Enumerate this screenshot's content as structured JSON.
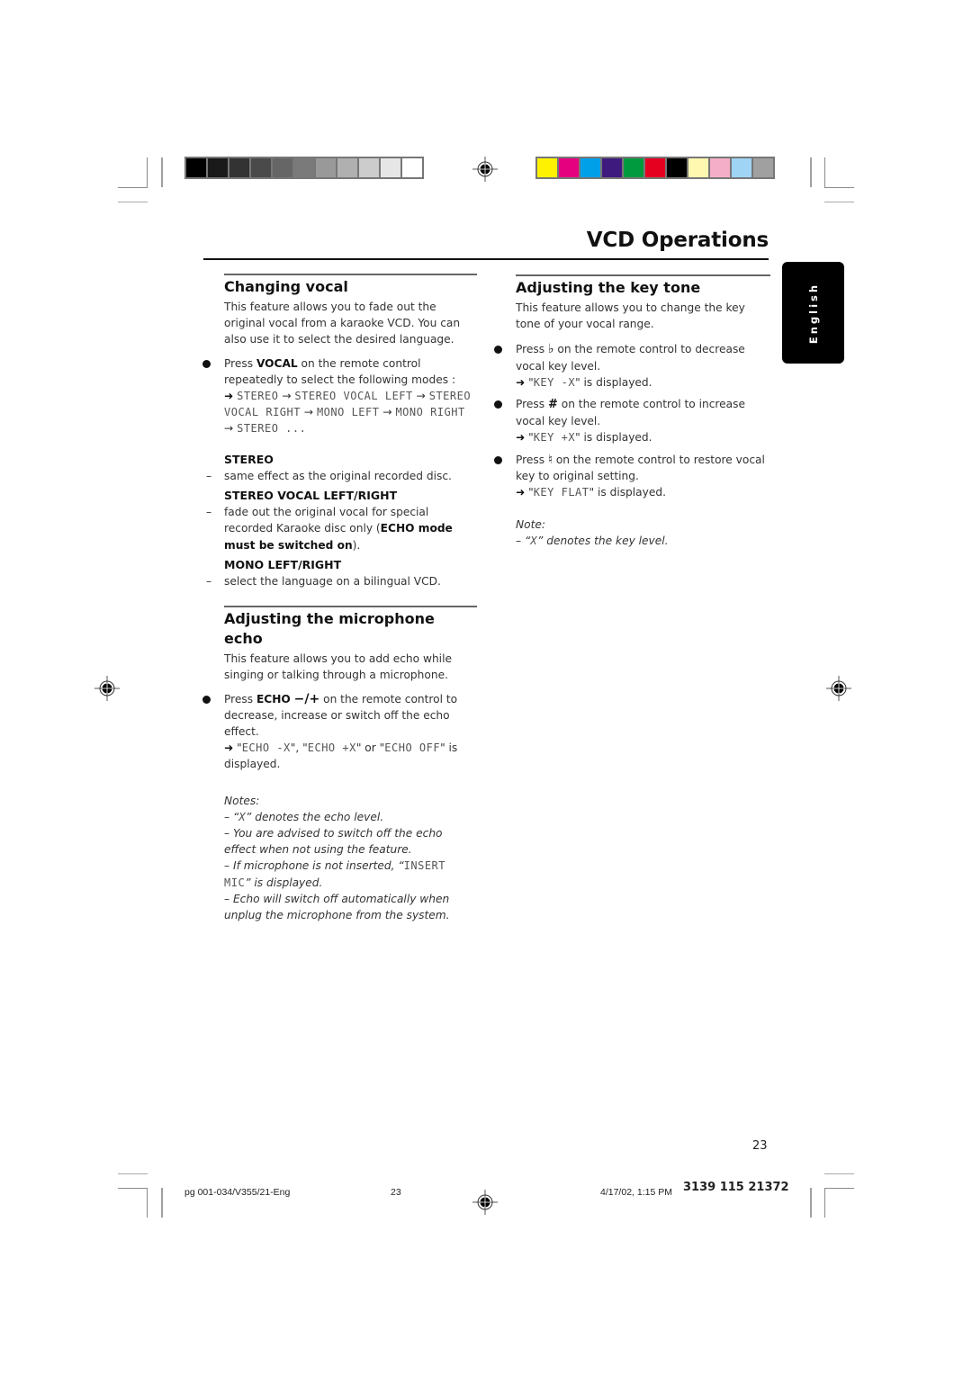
{
  "print_marks": {
    "gray_swatches": [
      "#000000",
      "#1a1a1a",
      "#333333",
      "#4a4a4a",
      "#666666",
      "#7a7a7a",
      "#999999",
      "#b0b0b0",
      "#cccccc",
      "#e6e6e6",
      "#ffffff"
    ],
    "color_swatches": [
      "#fff200",
      "#e4007f",
      "#00a0e9",
      "#3e1a7e",
      "#009a3e",
      "#e60020",
      "#000000",
      "#fff8b0",
      "#f4aec8",
      "#9fd4f5",
      "#a0a0a0"
    ]
  },
  "header": {
    "title": "VCD Operations"
  },
  "side_tab": {
    "label": "English"
  },
  "changing_vocal": {
    "heading": "Changing vocal",
    "intro": "This feature allows you to fade out the original vocal from a karaoke VCD. You can also use it to select the desired language.",
    "bullet": {
      "press": "Press ",
      "key": "VOCAL",
      "rest": " on the remote control repeatedly to select the following modes :",
      "sequence": [
        "STEREO",
        "STEREO VOCAL LEFT",
        "STEREO VOCAL RIGHT",
        "MONO LEFT",
        "MONO RIGHT",
        "STEREO ..."
      ]
    },
    "modes": [
      {
        "title": "STEREO",
        "desc": "same effect as the original recorded disc."
      },
      {
        "title": "STEREO VOCAL LEFT/RIGHT",
        "desc": "fade out the original vocal for special recorded Karaoke disc only (",
        "desc_bold": "ECHO mode must be switched on",
        "desc_end": ")."
      },
      {
        "title": "MONO LEFT/RIGHT",
        "desc": "select the language on a bilingual VCD."
      }
    ]
  },
  "mic_echo": {
    "heading": "Adjusting the microphone echo",
    "intro": "This feature allows you to add echo while singing or talking through a microphone.",
    "bullet": {
      "press": "Press ",
      "key": "ECHO",
      "key_symbols": "−/+",
      "rest": " on the remote control to decrease, increase or switch off the echo effect.",
      "displays": [
        "ECHO -X",
        "ECHO +X",
        "ECHO OFF"
      ],
      "sep1": "\", \"",
      "sep2": "\" or \"",
      "end": "\" is displayed."
    },
    "notes_label": "Notes:",
    "notes": [
      {
        "pre": "“",
        "lcd": "X",
        "post": "” denotes the echo level."
      },
      {
        "pre": "You are advised to switch off the echo effect when not using the feature.",
        "lcd": "",
        "post": ""
      },
      {
        "pre": "If microphone is not inserted, “",
        "lcd": "INSERT MIC",
        "post": "” is displayed."
      },
      {
        "pre": "Echo will switch off automatically when unplug the microphone from the system.",
        "lcd": "",
        "post": ""
      }
    ]
  },
  "key_tone": {
    "heading": "Adjusting the key tone",
    "intro": "This feature allows you to change the key tone of your vocal range.",
    "bullets": [
      {
        "press": "Press ",
        "symbol": "♭",
        "symbol_name": "flat-icon",
        "rest": " on the remote control to decrease vocal key level.",
        "display": "KEY -X",
        "end": "\" is displayed."
      },
      {
        "press": "Press ",
        "symbol": "#",
        "symbol_name": "sharp-icon",
        "rest": " on the remote control to increase vocal key level.",
        "display": "KEY +X",
        "end": "\" is displayed."
      },
      {
        "press": "Press ",
        "symbol": "♮",
        "symbol_name": "natural-icon",
        "rest": " on the remote control to restore vocal key to original setting.",
        "display": "KEY FLAT",
        "end": "\" is displayed."
      }
    ],
    "note_label": "Note:",
    "note": {
      "pre": "“",
      "lcd": "X",
      "post": "” denotes the key level."
    }
  },
  "page_number": "23",
  "footer": {
    "file": "pg 001-034/V355/21-Eng",
    "page": "23",
    "datetime": "4/17/02, 1:15 PM",
    "code": "3139 115 21372"
  }
}
